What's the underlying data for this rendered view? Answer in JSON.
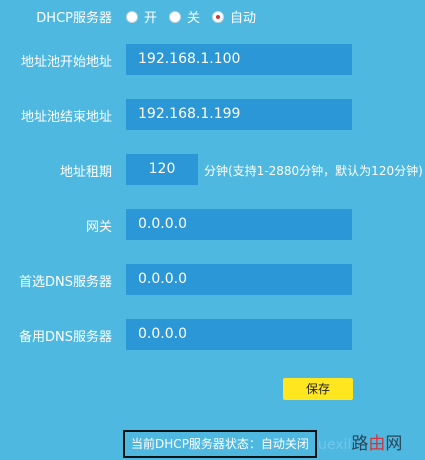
{
  "dhcp": {
    "label": "DHCP服务器",
    "options": [
      {
        "label": "开",
        "checked": false
      },
      {
        "label": "关",
        "checked": false
      },
      {
        "label": "自动",
        "checked": true
      }
    ]
  },
  "pool_start": {
    "label": "地址池开始地址",
    "value": "192.168.1.100"
  },
  "pool_end": {
    "label": "地址池结束地址",
    "value": "192.168.1.199"
  },
  "lease": {
    "label": "地址租期",
    "value": "120",
    "hint": "分钟(支持1-2880分钟，默认为120分钟)"
  },
  "gateway": {
    "label": "网关",
    "value": "0.0.0.0"
  },
  "dns_primary": {
    "label": "首选DNS服务器",
    "value": "0.0.0.0"
  },
  "dns_secondary": {
    "label": "备用DNS服务器",
    "value": "0.0.0.0"
  },
  "save_label": "保存",
  "status_text": "当前DHCP服务器状态：自动关闭",
  "watermark": {
    "faint": "uexil",
    "dark": "路",
    "accent": "由",
    "dark2": "网"
  },
  "colors": {
    "background": "#4fb8e0",
    "field": "#2b97d6",
    "save_button": "#ffe61f",
    "radio_selected": "#d8333a"
  }
}
